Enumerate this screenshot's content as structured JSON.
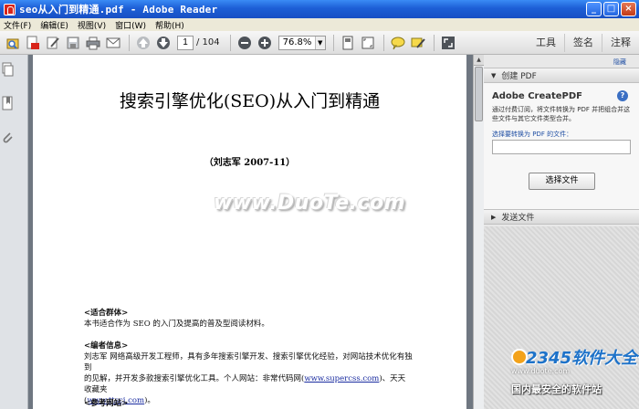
{
  "window": {
    "title": "seo从入门到精通.pdf - Adobe Reader",
    "min": "_",
    "max": "□",
    "close": "×"
  },
  "menu": [
    "文件(F)",
    "编辑(E)",
    "视图(V)",
    "窗口(W)",
    "帮助(H)"
  ],
  "toolbar": {
    "page_current": "1",
    "page_total": "/ 104",
    "zoom": "76.8%",
    "zoom_dd": "▼",
    "tabs": [
      "工具",
      "签名",
      "注释"
    ]
  },
  "document": {
    "title": "搜索引擎优化(SEO)从入门到精通",
    "author": "（刘志军  2007-11）",
    "watermark": "www.DuoTe.com",
    "audience_heading": "<适合群体>",
    "audience_text": "本书适合作为 SEO 的入门及提高的普及型阅读材料。",
    "editor_heading": "<编者信息>",
    "editor_text_1": "刘志军  网络高级开发工程师，具有多年搜索引擎开发、搜索引擎优化经验，对网站技术优化有独到",
    "editor_text_2a": "的见解，并开发多款搜索引擎优化工具。个人网站：非常代码网(",
    "editor_link_1": "www.supercss.com",
    "editor_text_2b": ")、天天收藏夹",
    "editor_text_3a": "(",
    "editor_link_2": "www.ttscj.com",
    "editor_text_3b": ")。",
    "ref_heading": "<参考网站>"
  },
  "right_panel": {
    "hide": "隐藏",
    "create_pdf_header": "创建 PDF",
    "create_title": "Adobe CreatePDF",
    "help": "?",
    "desc": "通过付费订阅，将文件转换为 PDF 并把组合并这些文件与其它文件类型合并。",
    "select_label": "选择要转换为 PDF 的文件：",
    "select_button": "选择文件",
    "send_files_header": "发送文件"
  },
  "watermark_2345": {
    "brand": "2345软件大全",
    "url": "www.duote.com",
    "slogan": "国内最安全的软件站"
  }
}
